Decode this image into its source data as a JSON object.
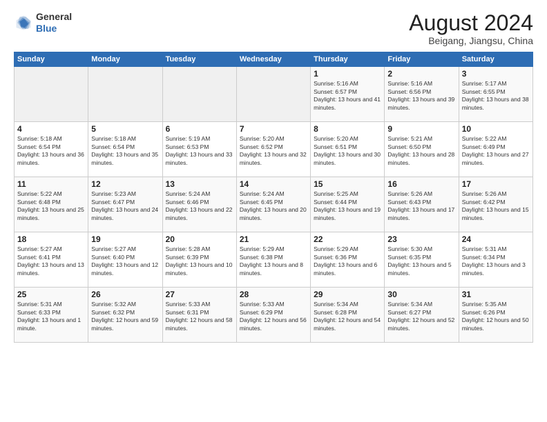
{
  "header": {
    "logo_line1": "General",
    "logo_line2": "Blue",
    "month_title": "August 2024",
    "subtitle": "Beigang, Jiangsu, China"
  },
  "days_of_week": [
    "Sunday",
    "Monday",
    "Tuesday",
    "Wednesday",
    "Thursday",
    "Friday",
    "Saturday"
  ],
  "weeks": [
    [
      {
        "day": "",
        "empty": true
      },
      {
        "day": "",
        "empty": true
      },
      {
        "day": "",
        "empty": true
      },
      {
        "day": "",
        "empty": true
      },
      {
        "day": "1",
        "sunrise": "5:16 AM",
        "sunset": "6:57 PM",
        "daylight": "13 hours and 41 minutes."
      },
      {
        "day": "2",
        "sunrise": "5:16 AM",
        "sunset": "6:56 PM",
        "daylight": "13 hours and 39 minutes."
      },
      {
        "day": "3",
        "sunrise": "5:17 AM",
        "sunset": "6:55 PM",
        "daylight": "13 hours and 38 minutes."
      }
    ],
    [
      {
        "day": "4",
        "sunrise": "5:18 AM",
        "sunset": "6:54 PM",
        "daylight": "13 hours and 36 minutes."
      },
      {
        "day": "5",
        "sunrise": "5:18 AM",
        "sunset": "6:54 PM",
        "daylight": "13 hours and 35 minutes."
      },
      {
        "day": "6",
        "sunrise": "5:19 AM",
        "sunset": "6:53 PM",
        "daylight": "13 hours and 33 minutes."
      },
      {
        "day": "7",
        "sunrise": "5:20 AM",
        "sunset": "6:52 PM",
        "daylight": "13 hours and 32 minutes."
      },
      {
        "day": "8",
        "sunrise": "5:20 AM",
        "sunset": "6:51 PM",
        "daylight": "13 hours and 30 minutes."
      },
      {
        "day": "9",
        "sunrise": "5:21 AM",
        "sunset": "6:50 PM",
        "daylight": "13 hours and 28 minutes."
      },
      {
        "day": "10",
        "sunrise": "5:22 AM",
        "sunset": "6:49 PM",
        "daylight": "13 hours and 27 minutes."
      }
    ],
    [
      {
        "day": "11",
        "sunrise": "5:22 AM",
        "sunset": "6:48 PM",
        "daylight": "13 hours and 25 minutes."
      },
      {
        "day": "12",
        "sunrise": "5:23 AM",
        "sunset": "6:47 PM",
        "daylight": "13 hours and 24 minutes."
      },
      {
        "day": "13",
        "sunrise": "5:24 AM",
        "sunset": "6:46 PM",
        "daylight": "13 hours and 22 minutes."
      },
      {
        "day": "14",
        "sunrise": "5:24 AM",
        "sunset": "6:45 PM",
        "daylight": "13 hours and 20 minutes."
      },
      {
        "day": "15",
        "sunrise": "5:25 AM",
        "sunset": "6:44 PM",
        "daylight": "13 hours and 19 minutes."
      },
      {
        "day": "16",
        "sunrise": "5:26 AM",
        "sunset": "6:43 PM",
        "daylight": "13 hours and 17 minutes."
      },
      {
        "day": "17",
        "sunrise": "5:26 AM",
        "sunset": "6:42 PM",
        "daylight": "13 hours and 15 minutes."
      }
    ],
    [
      {
        "day": "18",
        "sunrise": "5:27 AM",
        "sunset": "6:41 PM",
        "daylight": "13 hours and 13 minutes."
      },
      {
        "day": "19",
        "sunrise": "5:27 AM",
        "sunset": "6:40 PM",
        "daylight": "13 hours and 12 minutes."
      },
      {
        "day": "20",
        "sunrise": "5:28 AM",
        "sunset": "6:39 PM",
        "daylight": "13 hours and 10 minutes."
      },
      {
        "day": "21",
        "sunrise": "5:29 AM",
        "sunset": "6:38 PM",
        "daylight": "13 hours and 8 minutes."
      },
      {
        "day": "22",
        "sunrise": "5:29 AM",
        "sunset": "6:36 PM",
        "daylight": "13 hours and 6 minutes."
      },
      {
        "day": "23",
        "sunrise": "5:30 AM",
        "sunset": "6:35 PM",
        "daylight": "13 hours and 5 minutes."
      },
      {
        "day": "24",
        "sunrise": "5:31 AM",
        "sunset": "6:34 PM",
        "daylight": "13 hours and 3 minutes."
      }
    ],
    [
      {
        "day": "25",
        "sunrise": "5:31 AM",
        "sunset": "6:33 PM",
        "daylight": "13 hours and 1 minute."
      },
      {
        "day": "26",
        "sunrise": "5:32 AM",
        "sunset": "6:32 PM",
        "daylight": "12 hours and 59 minutes."
      },
      {
        "day": "27",
        "sunrise": "5:33 AM",
        "sunset": "6:31 PM",
        "daylight": "12 hours and 58 minutes."
      },
      {
        "day": "28",
        "sunrise": "5:33 AM",
        "sunset": "6:29 PM",
        "daylight": "12 hours and 56 minutes."
      },
      {
        "day": "29",
        "sunrise": "5:34 AM",
        "sunset": "6:28 PM",
        "daylight": "12 hours and 54 minutes."
      },
      {
        "day": "30",
        "sunrise": "5:34 AM",
        "sunset": "6:27 PM",
        "daylight": "12 hours and 52 minutes."
      },
      {
        "day": "31",
        "sunrise": "5:35 AM",
        "sunset": "6:26 PM",
        "daylight": "12 hours and 50 minutes."
      }
    ]
  ]
}
